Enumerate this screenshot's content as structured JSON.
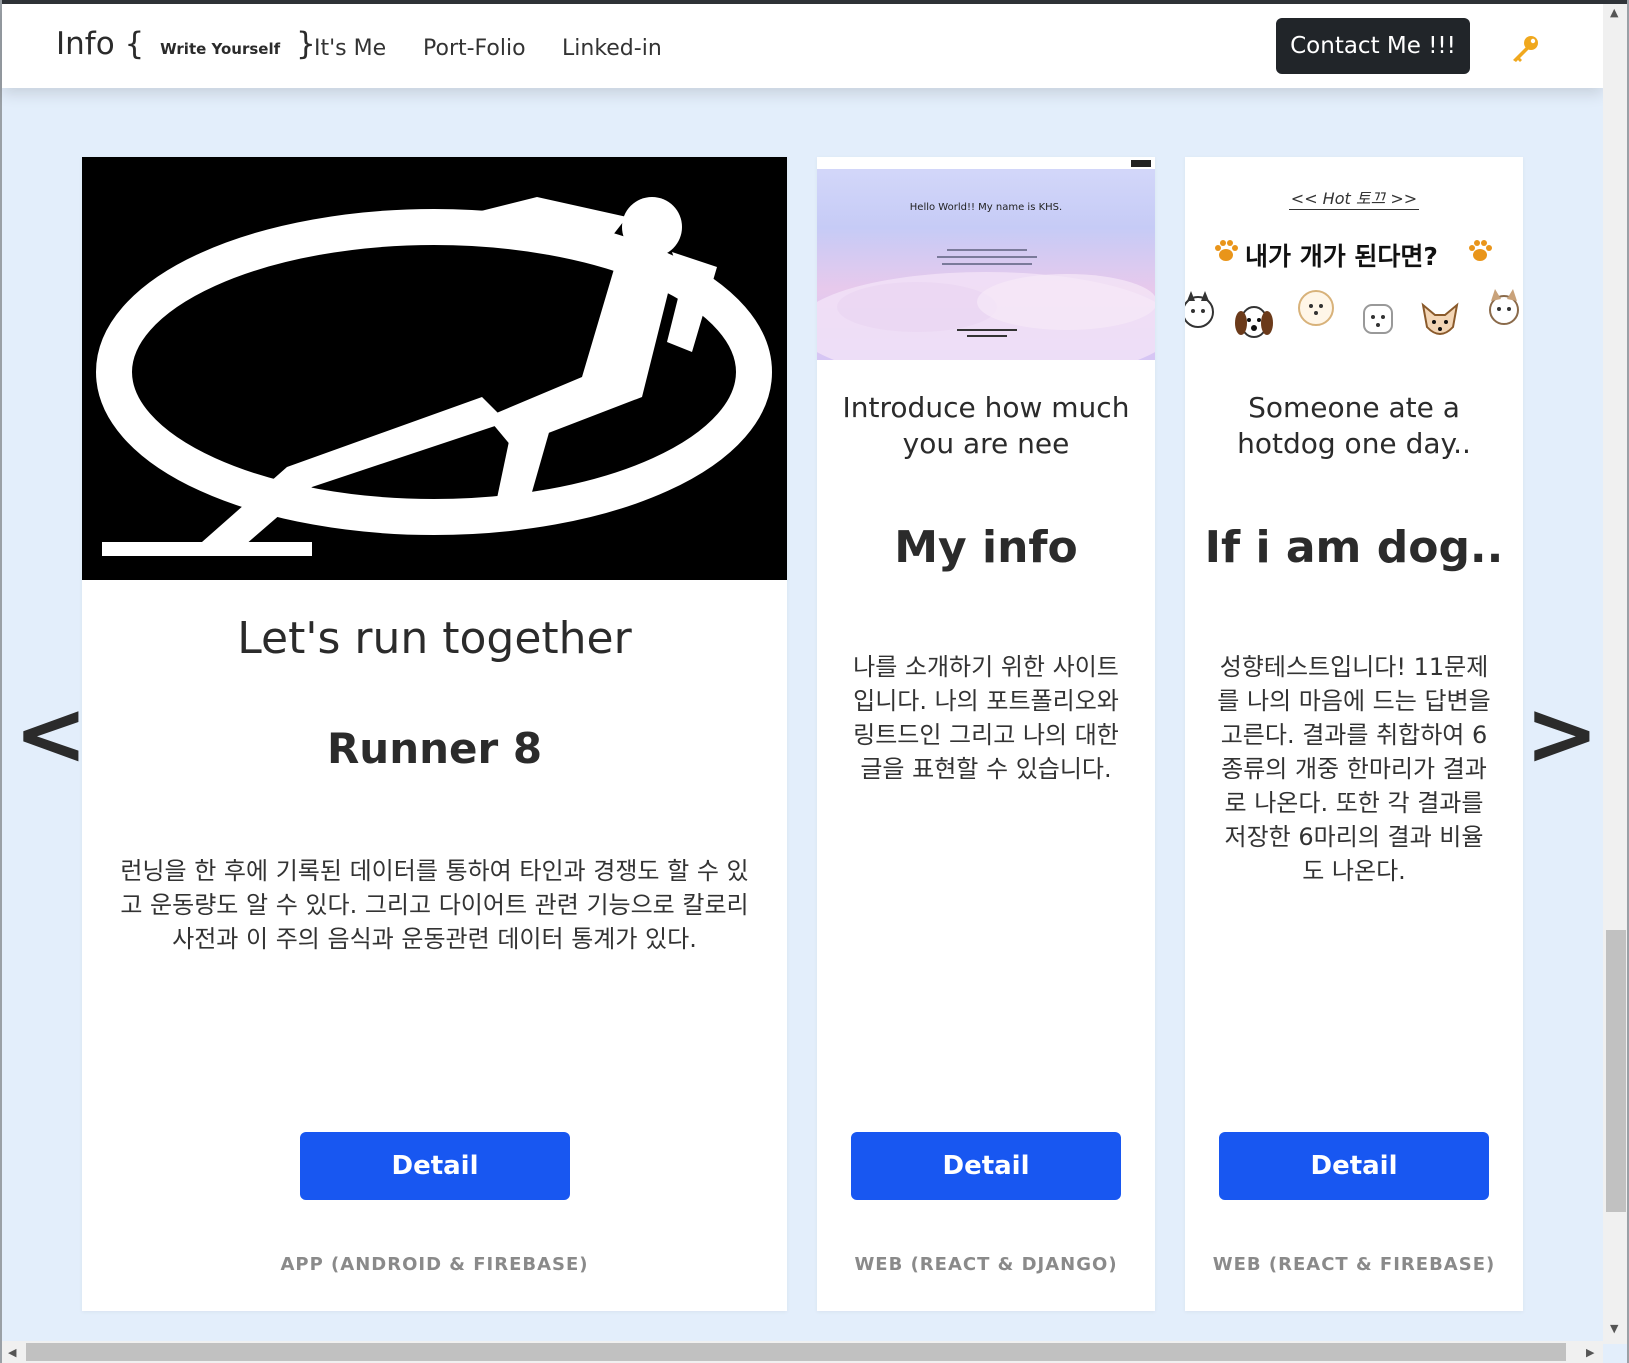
{
  "navbar": {
    "brand_main": "Info",
    "brand_open": "{",
    "brand_sub": "Write Yourself",
    "brand_close": "}",
    "links": [
      "It's Me",
      "Port-Folio",
      "Linked-in"
    ],
    "contact_label": "Contact Me !!!",
    "key_icon": "key-icon"
  },
  "carousel": {
    "prev_label": "<",
    "next_label": ">",
    "cards": [
      {
        "subtitle": "Let's run together",
        "title": "Runner 8",
        "desc": "런닝을 한 후에 기록된 데이터를 통하여 타인과 경쟁도 할 수 있고 운동량도 알 수 있다. 그리고 다이어트 관련 기능으로 칼로리 사전과 이 주의 음식과 운동관련 데이터 통계가 있다.",
        "button": "Detail",
        "tech": "APP (ANDROID & FIREBASE)"
      },
      {
        "preview_heading": "Hello World!!   My name is KHS.",
        "subtitle": "Introduce how much you are nee",
        "title": "My info",
        "desc": "나를 소개하기 위한 사이트입니다. 나의 포트폴리오와 링트드인 그리고 나의 대한 글을 표현할 수 있습니다.",
        "button": "Detail",
        "tech": "WEB (REACT & DJANGO)"
      },
      {
        "preview_tag": "<< Hot 토끄 >>",
        "preview_title": "내가 개가 된다면?",
        "subtitle": "Someone ate a hotdog one day..",
        "title": "If i am dog..",
        "desc": "성향테스트입니다! 11문제를 나의 마음에 드는 답변을 고른다. 결과를 취합하여 6 종류의 개중 한마리가 결과로 나온다. 또한 각 결과를 저장한 6마리의 결과 비율도 나온다.",
        "button": "Detail",
        "tech": "WEB (REACT & FIREBASE)"
      }
    ]
  },
  "colors": {
    "page_bg": "#e3eefb",
    "button_blue": "#1857f1",
    "contact_dark": "#212529",
    "key_gold": "#f0a81e"
  }
}
